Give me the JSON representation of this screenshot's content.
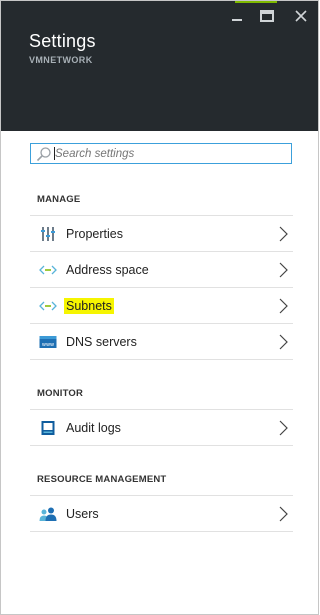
{
  "header": {
    "title": "Settings",
    "subtitle": "VMNETWORK",
    "accent_color": "#7fba00",
    "window_controls": [
      "minimize-icon",
      "maximize-icon",
      "close-icon"
    ]
  },
  "search": {
    "placeholder": "Search settings",
    "value": ""
  },
  "sections": {
    "manage": {
      "label": "MANAGE",
      "items": [
        {
          "label": "Properties",
          "icon": "properties-sliders-icon"
        },
        {
          "label": "Address space",
          "icon": "address-space-icon"
        },
        {
          "label": "Subnets",
          "icon": "subnets-icon",
          "highlighted": true,
          "highlight_color": "#f6f500"
        },
        {
          "label": "DNS servers",
          "icon": "dns-servers-icon"
        }
      ]
    },
    "monitor": {
      "label": "MONITOR",
      "items": [
        {
          "label": "Audit logs",
          "icon": "audit-logs-icon"
        }
      ]
    },
    "resource_management": {
      "label": "RESOURCE MANAGEMENT",
      "items": [
        {
          "label": "Users",
          "icon": "users-icon"
        }
      ]
    }
  }
}
